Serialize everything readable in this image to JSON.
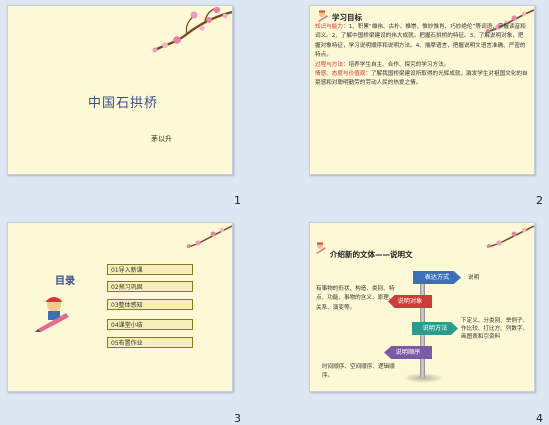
{
  "slides": [
    {
      "number": "1",
      "title": "中国石拱桥",
      "author": "茅以升"
    },
    {
      "number": "2",
      "heading": "学习目标",
      "abilities_label": "知识与能力：",
      "abilities_text": "1、积累“雄伟、古朴、推崇、惟妙惟肖、巧妙绝伦”等词语，掌握读音和词义。2、了解中国桥梁建设的伟大成就，把握石拱桥的特征。3、了解说明对象，把握对象特征，学习说明顺序和说明方法。4、揣摩语言，把握说明文语言准确、严密的特点。",
      "process_label": "过程与方法：",
      "process_text": "培养学生自主、合作、探究的学习方法。",
      "emotion_label": "情感、态度与价值观：",
      "emotion_text": "了解我国桥梁建设所取得的光辉成就，激发学生对祖国文化的自豪感和对聪明勤劳的劳动人民的热爱之情。"
    },
    {
      "number": "3",
      "heading": "目录",
      "items": [
        "01导入新课",
        "02预习巩固",
        "03整体感知",
        "04课堂小结",
        "05布置作业"
      ]
    },
    {
      "number": "4",
      "heading": "介绍新的文体——说明文",
      "sign_1": "表达方式",
      "sign_1_note": "说明",
      "sign_2": "说明对象",
      "sign_2_note": "有事物的形状、构造、类别、特点、功能、事物的含义、原理、关系、演变等。",
      "sign_3": "说明方法",
      "sign_3_note": "下定义、分类别、举例子、作比较、打比方、列数字、画图表和引资料",
      "sign_4": "说明顺序",
      "sign_4_note": "时间顺序、空间顺序、逻辑顺序。"
    }
  ],
  "colors": {
    "slide_bg": "#fdf8d6",
    "title_blue": "#3b4e8c",
    "accent_red": "#dd3333",
    "sign_blue": "#3d6fb8",
    "sign_red": "#cc3d38",
    "sign_teal": "#2f9a8d",
    "sign_purple": "#7b5aa6"
  }
}
